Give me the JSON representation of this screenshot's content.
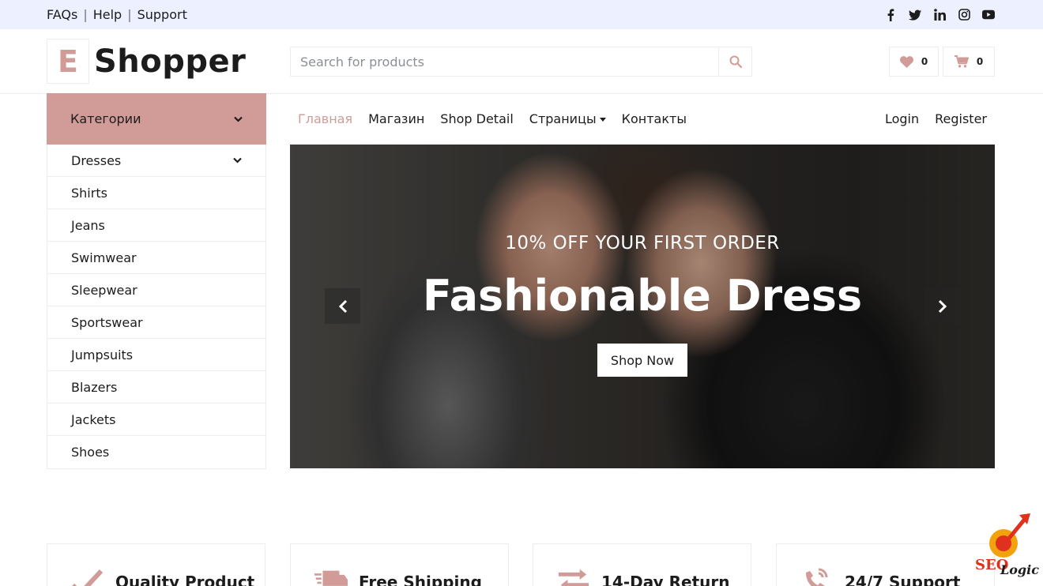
{
  "topbar": {
    "links": [
      "FAQs",
      "Help",
      "Support"
    ],
    "separator": "|",
    "social_icons": [
      "facebook-icon",
      "twitter-icon",
      "linkedin-icon",
      "instagram-icon",
      "youtube-icon"
    ]
  },
  "logo": {
    "letter": "E",
    "word": "Shopper"
  },
  "search": {
    "placeholder": "Search for products",
    "value": "",
    "icon": "search-icon"
  },
  "header_buttons": {
    "wishlist_count": "0",
    "cart_count": "0"
  },
  "sidebar": {
    "header": "Категории",
    "items": [
      "Dresses",
      "Shirts",
      "Jeans",
      "Swimwear",
      "Sleepwear",
      "Sportswear",
      "Jumpsuits",
      "Blazers",
      "Jackets",
      "Shoes"
    ]
  },
  "nav": {
    "items": [
      "Главная",
      "Магазин",
      "Shop Detail",
      "Страницы",
      "Контакты"
    ],
    "right": [
      "Login",
      "Register"
    ]
  },
  "hero": {
    "subtitle": "10% OFF YOUR FIRST ORDER",
    "title": "Fashionable Dress",
    "button": "Shop Now"
  },
  "features": [
    {
      "icon": "check-icon",
      "label": "Quality Product"
    },
    {
      "icon": "shipping-icon",
      "label": "Free Shipping"
    },
    {
      "icon": "exchange-icon",
      "label": "14-Day Return"
    },
    {
      "icon": "phone-icon",
      "label": "24/7 Support"
    }
  ],
  "watermark": {
    "text_1": "SEO",
    "text_2": "Logic"
  },
  "colors": {
    "primary": "#d19c97",
    "secondary": "#edf1ff",
    "dark": "#1c1c1c",
    "border": "#ededed"
  }
}
